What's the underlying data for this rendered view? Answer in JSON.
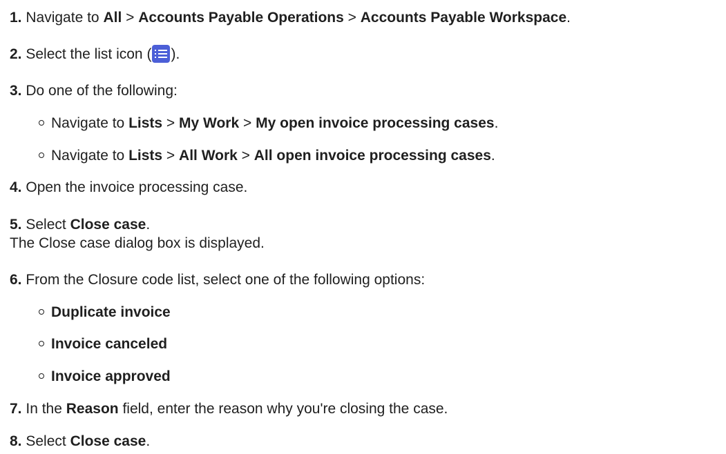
{
  "steps": [
    {
      "num": "1.",
      "parts": {
        "a": "Navigate to ",
        "b1": "All",
        "s1": " > ",
        "b2": "Accounts Payable Operations",
        "s2": " > ",
        "b3": "Accounts Payable Workspace",
        "end": "."
      }
    },
    {
      "num": "2.",
      "parts": {
        "a": "Select the list icon (",
        "icon": "list-icon",
        "end": ")."
      }
    },
    {
      "num": "3.",
      "text": "Do one of the following:",
      "options": [
        {
          "a": "Navigate to ",
          "b1": "Lists",
          "s1": " > ",
          "b2": "My Work",
          "s2": " > ",
          "b3": "My open invoice processing cases",
          "end": "."
        },
        {
          "a": "Navigate to ",
          "b1": "Lists",
          "s1": " > ",
          "b2": "All Work",
          "s2": " > ",
          "b3": "All open invoice processing cases",
          "end": "."
        }
      ]
    },
    {
      "num": "4.",
      "text": "Open the invoice processing case."
    },
    {
      "num": "5.",
      "parts": {
        "a": "Select ",
        "b1": "Close case",
        "end": "."
      },
      "result": "The Close case dialog box is displayed."
    },
    {
      "num": "6.",
      "text": "From the Closure code list, select one of the following options:",
      "options": [
        "Duplicate invoice",
        "Invoice canceled",
        "Invoice approved"
      ]
    },
    {
      "num": "7.",
      "parts": {
        "a": "In the ",
        "b1": "Reason",
        "end": " field, enter the reason why you're closing the case."
      }
    },
    {
      "num": "8.",
      "parts": {
        "a": "Select ",
        "b1": "Close case",
        "end": "."
      }
    }
  ],
  "colors": {
    "text": "#1f1f1f",
    "icon_bg": "#4c5fd7"
  }
}
